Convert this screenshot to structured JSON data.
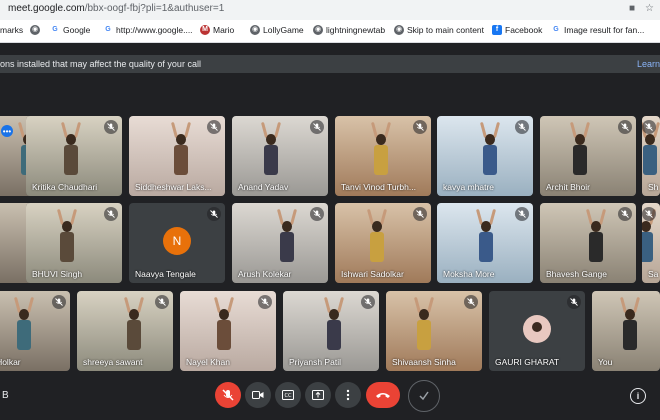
{
  "browser": {
    "url_host": "meet.google.com",
    "url_path": "/bbx-oogf-fbj?pli=1&authuser=1"
  },
  "bookmarks": [
    {
      "label": "marks",
      "icon": "bookmark-icon"
    },
    {
      "label": "",
      "icon": "globe-icon"
    },
    {
      "label": "Google",
      "icon": "google-icon"
    },
    {
      "label": "http://www.google....",
      "icon": "google-icon"
    },
    {
      "label": "Mario",
      "icon": "mario-icon"
    },
    {
      "label": "LollyGame",
      "icon": "globe-icon"
    },
    {
      "label": "lightningnewtab",
      "icon": "globe-icon"
    },
    {
      "label": "Skip to main content",
      "icon": "globe-icon"
    },
    {
      "label": "Facebook",
      "icon": "facebook-icon"
    },
    {
      "label": "Image result for fan...",
      "icon": "google-icon"
    }
  ],
  "banner": {
    "message": "ons installed that may affect the quality of your call",
    "link": "Learn"
  },
  "participants": [
    {
      "name": "",
      "row": 0,
      "col": 0
    },
    {
      "name": "Kritika Chaudhari",
      "row": 0,
      "col": 1
    },
    {
      "name": "Siddheshwar Laks...",
      "row": 0,
      "col": 2
    },
    {
      "name": "Anand Yadav",
      "row": 0,
      "col": 3
    },
    {
      "name": "Tanvi Vinod Turbh...",
      "row": 0,
      "col": 4
    },
    {
      "name": "kavya mhatre",
      "row": 0,
      "col": 5
    },
    {
      "name": "Archit Bhoir",
      "row": 0,
      "col": 6
    },
    {
      "name": "Sh",
      "row": 0,
      "col": 7
    },
    {
      "name": "",
      "row": 1,
      "col": 0
    },
    {
      "name": "BHUVI Singh",
      "row": 1,
      "col": 1
    },
    {
      "name": "Naavya Tengale",
      "row": 1,
      "col": 2,
      "avatar_letter": "N"
    },
    {
      "name": "Arush Kolekar",
      "row": 1,
      "col": 3
    },
    {
      "name": "Ishwari Sadolkar",
      "row": 1,
      "col": 4
    },
    {
      "name": "Moksha More",
      "row": 1,
      "col": 5
    },
    {
      "name": "Bhavesh Gange",
      "row": 1,
      "col": 6
    },
    {
      "name": "Sa",
      "row": 1,
      "col": 7
    },
    {
      "name": "esh Holkar",
      "row": 2,
      "col": 0
    },
    {
      "name": "shreeya sawant",
      "row": 2,
      "col": 1
    },
    {
      "name": "Nayel Khan",
      "row": 2,
      "col": 2
    },
    {
      "name": "Priyansh Patil",
      "row": 2,
      "col": 3
    },
    {
      "name": "Shivaansh Sinha",
      "row": 2,
      "col": 4
    },
    {
      "name": "GAURI GHARAT",
      "row": 2,
      "col": 5
    },
    {
      "name": "You",
      "row": 2,
      "col": 6
    }
  ],
  "bottom_bar": {
    "left_label": "B",
    "info": "i"
  },
  "colors": {
    "meet_bg": "#202124",
    "tile_bg": "#3c4043",
    "end_call_red": "#ea4335",
    "avatar_orange": "#e8710a",
    "link_blue": "#8ab4f8"
  }
}
